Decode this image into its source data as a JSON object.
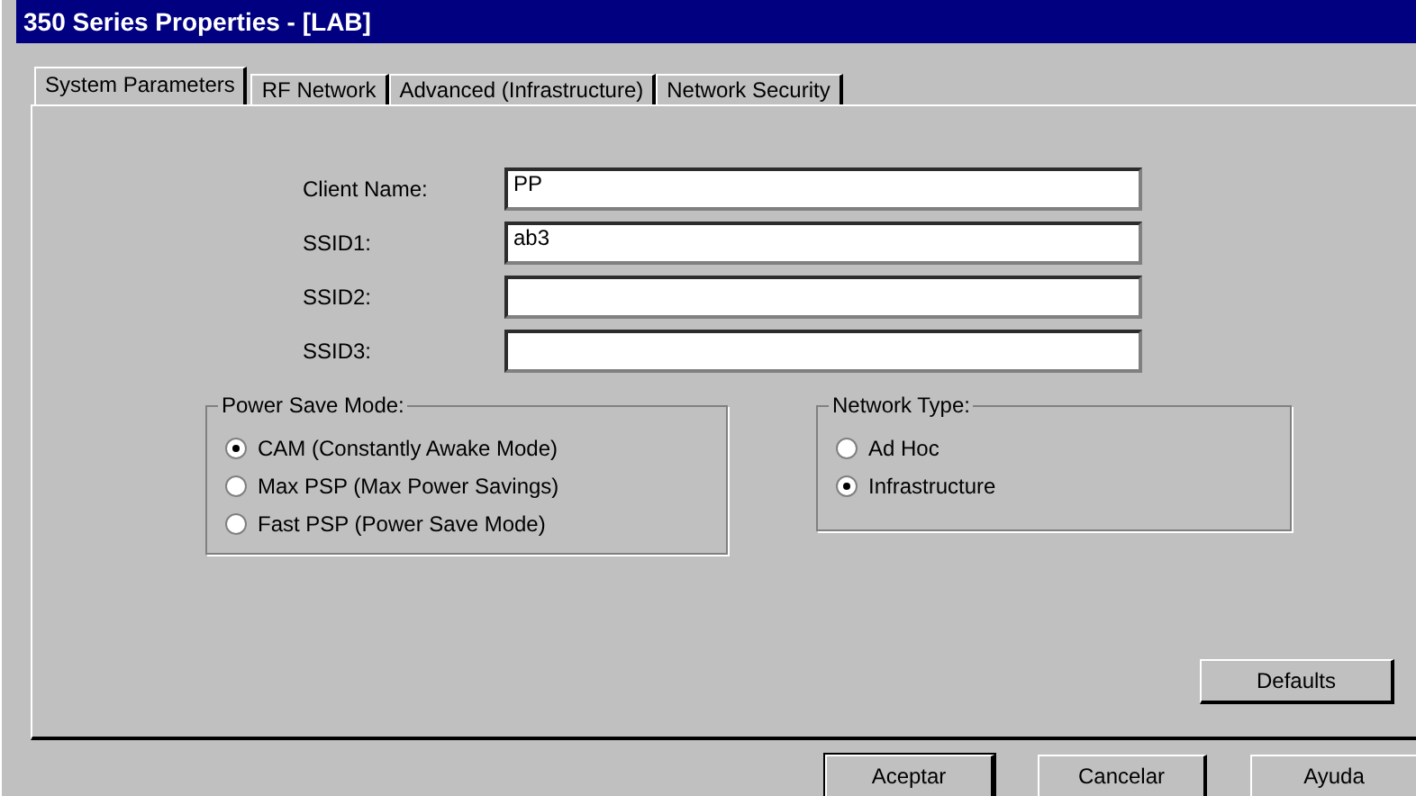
{
  "window": {
    "title": "350 Series Properties - [LAB]"
  },
  "tabs": [
    {
      "label": "System Parameters",
      "selected": true
    },
    {
      "label": "RF Network",
      "selected": false
    },
    {
      "label": "Advanced (Infrastructure)",
      "selected": false
    },
    {
      "label": "Network Security",
      "selected": false
    }
  ],
  "fields": [
    {
      "label": "Client Name:",
      "value": "PP"
    },
    {
      "label": "SSID1:",
      "value": "ab3"
    },
    {
      "label": "SSID2:"
    },
    {
      "label": "SSID3:"
    }
  ],
  "power_save_mode": {
    "title": "Power Save Mode:",
    "options": [
      {
        "label": "CAM (Constantly Awake Mode)",
        "selected": true
      },
      {
        "label": "Max PSP (Max Power Savings)",
        "selected": false
      },
      {
        "label": "Fast PSP (Power Save Mode)",
        "selected": false
      }
    ]
  },
  "network_type": {
    "title": "Network Type:",
    "options": [
      {
        "label": "Ad Hoc",
        "selected": false
      },
      {
        "label": "Infrastructure",
        "selected": true
      }
    ]
  },
  "defaults_button": "Defaults",
  "buttons": [
    "Aceptar",
    "Cancelar",
    "Ayuda"
  ]
}
